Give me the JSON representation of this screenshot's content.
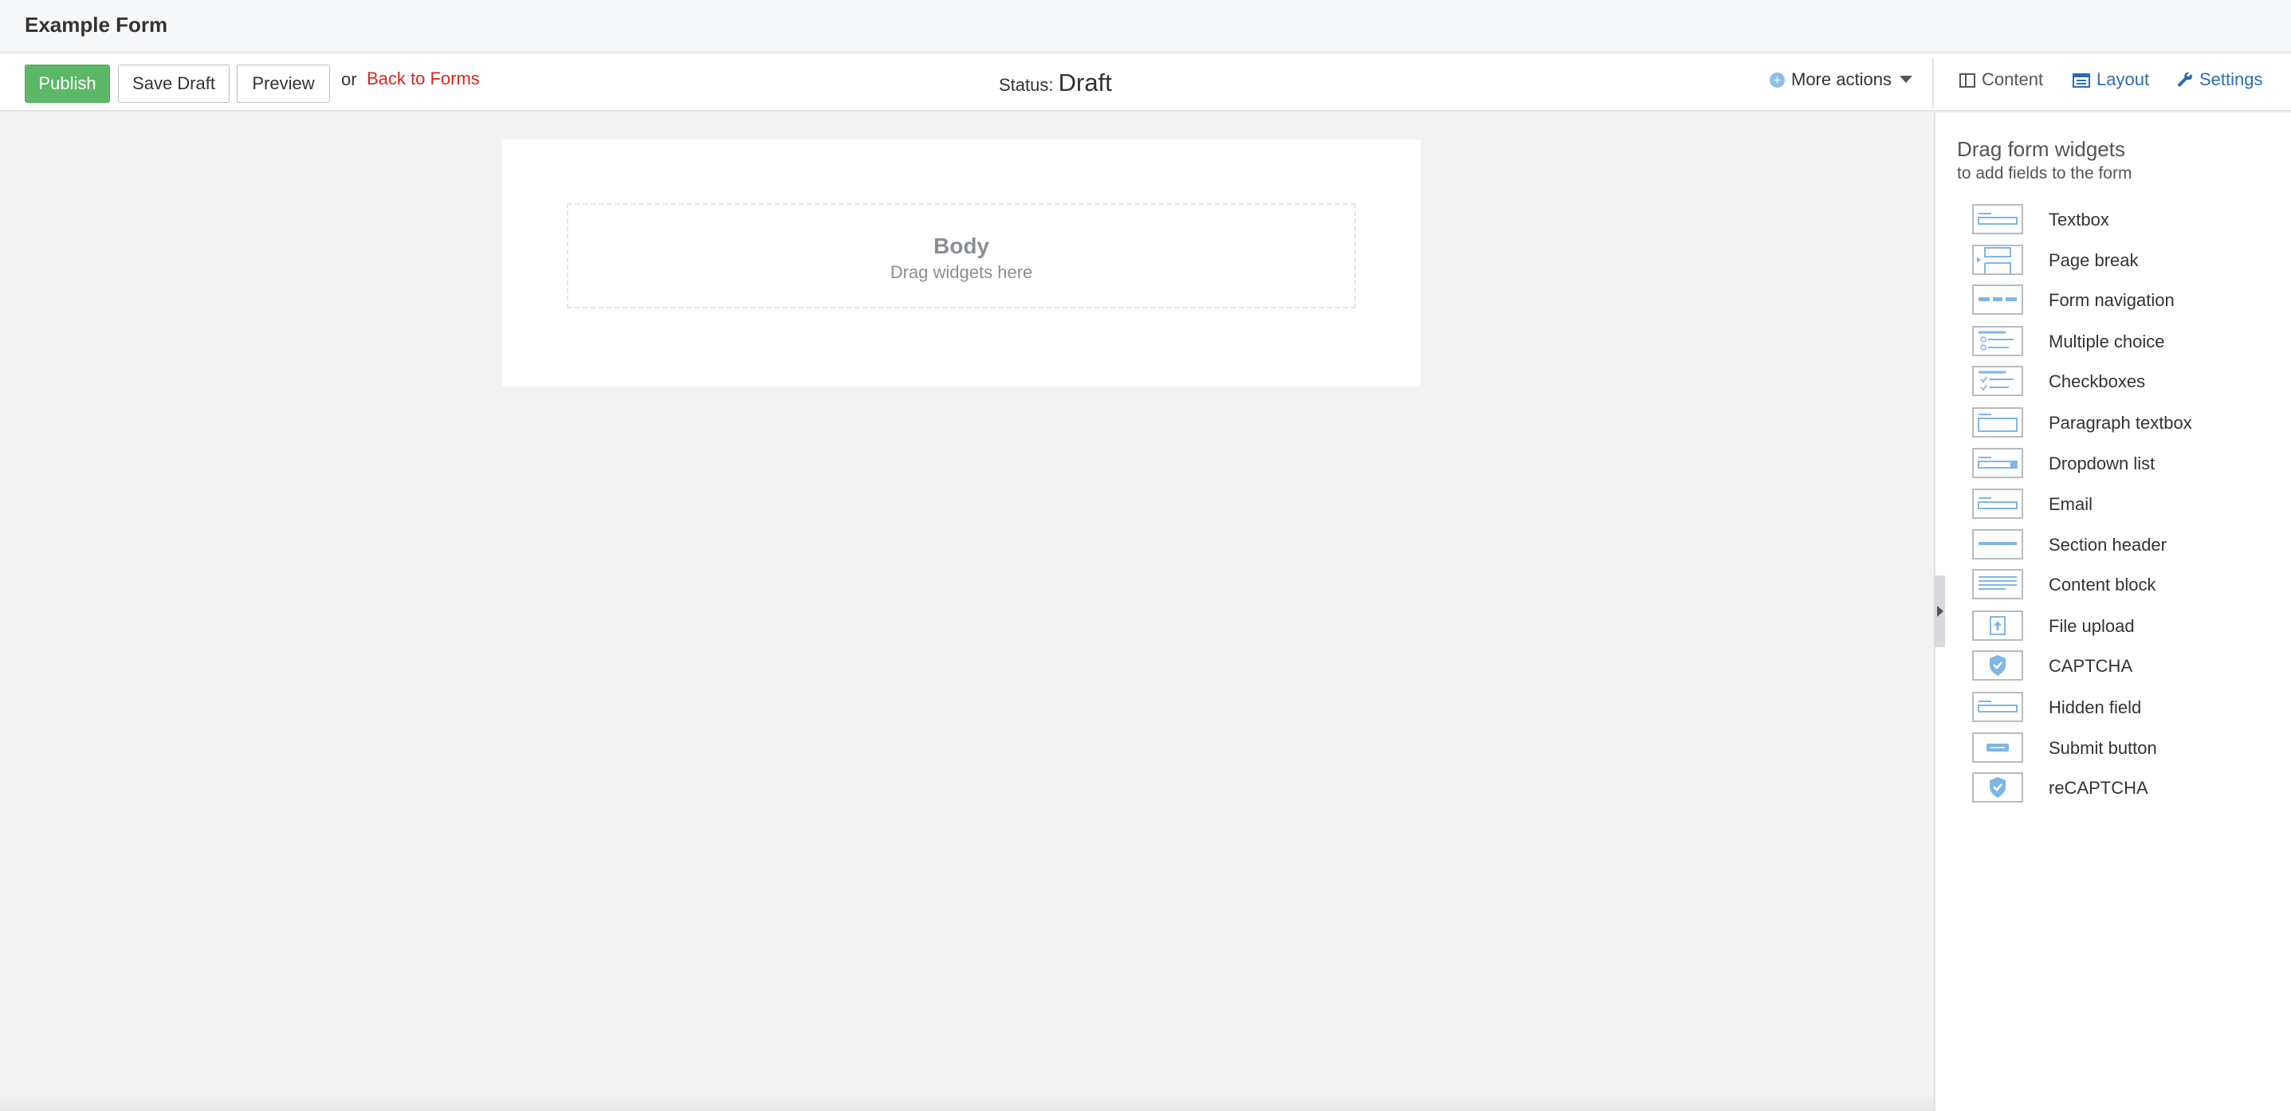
{
  "header": {
    "title": "Example Form"
  },
  "toolbar": {
    "publish_label": "Publish",
    "save_draft_label": "Save Draft",
    "preview_label": "Preview",
    "or_text": "or",
    "back_label": "Back to Forms",
    "status_label": "Status:",
    "status_value": "Draft",
    "more_actions_label": "More actions"
  },
  "view_tabs": {
    "content": "Content",
    "layout": "Layout",
    "settings": "Settings"
  },
  "form": {
    "body_title": "Body",
    "body_hint": "Drag widgets here"
  },
  "panel": {
    "heading": "Drag form widgets",
    "subheading": "to add fields to the form",
    "widgets": [
      {
        "label": "Textbox",
        "icon": "textbox-icon"
      },
      {
        "label": "Page break",
        "icon": "page-break-icon"
      },
      {
        "label": "Form navigation",
        "icon": "form-navigation-icon"
      },
      {
        "label": "Multiple choice",
        "icon": "multiple-choice-icon"
      },
      {
        "label": "Checkboxes",
        "icon": "checkboxes-icon"
      },
      {
        "label": "Paragraph textbox",
        "icon": "paragraph-textbox-icon"
      },
      {
        "label": "Dropdown list",
        "icon": "dropdown-list-icon"
      },
      {
        "label": "Email",
        "icon": "email-icon"
      },
      {
        "label": "Section header",
        "icon": "section-header-icon"
      },
      {
        "label": "Content block",
        "icon": "content-block-icon"
      },
      {
        "label": "File upload",
        "icon": "file-upload-icon"
      },
      {
        "label": "CAPTCHA",
        "icon": "captcha-icon"
      },
      {
        "label": "Hidden field",
        "icon": "hidden-field-icon"
      },
      {
        "label": "Submit button",
        "icon": "submit-button-icon"
      },
      {
        "label": "reCAPTCHA",
        "icon": "recaptcha-icon"
      }
    ]
  },
  "colors": {
    "publish_green": "#5cb866",
    "link_red": "#d9261c",
    "tab_blue": "#2a6cb3",
    "icon_blue": "#7fb6e6"
  }
}
